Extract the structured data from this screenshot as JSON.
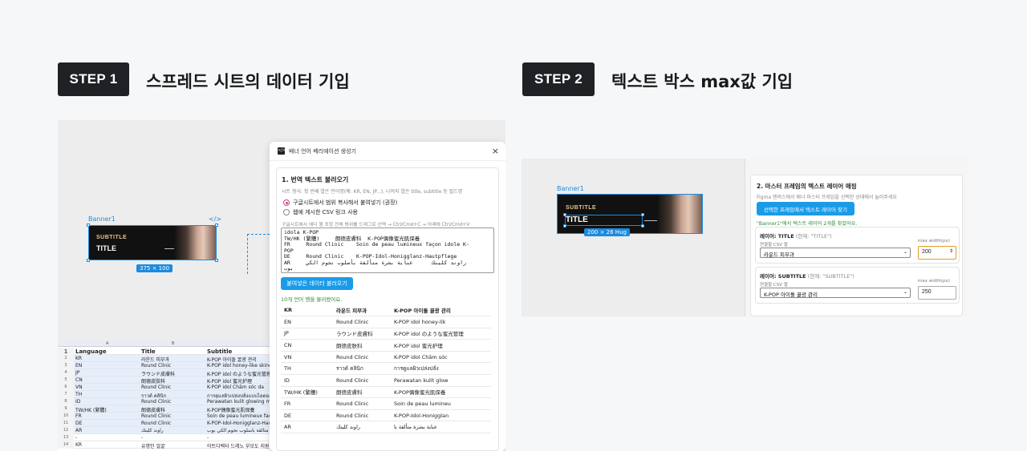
{
  "step1": {
    "badge": "STEP 1",
    "title": "스프레드 시트의 데이터 기입"
  },
  "step2": {
    "badge": "STEP 2",
    "title": "텍스트 박스 max값 기입"
  },
  "left": {
    "frame_label": "Banner1",
    "frame_code_icon": "</>",
    "banner_subtitle": "SUBTITLE",
    "banner_title": "TITLE",
    "dimension": "375 × 100",
    "sheet": {
      "col_letters": [
        "A",
        "B"
      ],
      "header": [
        "Language",
        "Title",
        "Subtitle"
      ],
      "rows": [
        [
          "1",
          "",
          "",
          ""
        ],
        [
          "2",
          "KR",
          "라운드 피부과",
          "K-POP 아이돌 꿀광 관리"
        ],
        [
          "3",
          "EN",
          "Round Clinic",
          "K-POP idol honey-like skincare"
        ],
        [
          "4",
          "JP",
          "ラウンド皮膚科",
          "K-POP idol のような蜜光管理"
        ],
        [
          "5",
          "CN",
          "朗德皮肤科",
          "K-POP idol 蜜光护理"
        ],
        [
          "6",
          "VN",
          "Round Clinic",
          "K-POP idol Chăm sóc da"
        ],
        [
          "7",
          "TH",
          "ราวด์ คลินิก",
          "การดูแลผิวเปล่งปลั่งแบบไอดอล"
        ],
        [
          "8",
          "ID",
          "Round Clinic",
          "Perawatan kulit glowing madu"
        ],
        [
          "9",
          "TW/HK (繁體)",
          "朗德皮膚科",
          "K-POP偶像蜜光肌保養"
        ],
        [
          "10",
          "FR",
          "Round Clinic",
          "Soin de peau lumineux façon"
        ],
        [
          "11",
          "DE",
          "Round Clinic",
          "K-POP-Idol-Honigglanz-Hautp"
        ],
        [
          "12",
          "AR",
          "راوند كلينك",
          "عناية بشرة متألقة بأسلوب نجوم الكي بوب"
        ],
        [
          "13",
          "-",
          "-",
          "-"
        ],
        [
          "14",
          "KR",
          "유명인 얼굴",
          "아트디렉터 드레노 부모도 지원"
        ]
      ]
    },
    "dialog": {
      "icon": "</>",
      "title": "배너 언어 베리에이션 생성기",
      "close": "×",
      "section_title": "1. 번역 텍스트 불러오기",
      "section_hint": "시트 형식: 첫 번째 열은 언어명(예: KR, EN, JP...), 나머지 열은 title, subtitle 등 필드명",
      "radio1": "구글시트에서 범위 복사해서 붙여넣기 (권장)",
      "radio2": "웹에 게시한 CSV 링크 사용",
      "paste_hint": "구글시트에서 헤더 행 포함 전체 범위를 드래그로 선택 → Ctrl/Cmd+C → 아래에 Ctrl/Cmd+V",
      "paste_text": "idola K-POP\nTW/HK (繁體)     朗德皮膚科  K-POP偶像蜜光肌保養\nFR     Round Clinic    Soin de peau lumineux façon idole K-\nPOP\nDE     Round Clinic    K-POP-Idol-Honigglanz-Hautpflege\nAR     راوند كلينك      عناية بشرة متألقة بأسلوب نجوم الكي\nبوب",
      "load_button": "붙여넣은 데이터 불러오기",
      "status": "10개 언어 행을 불러왔어요.",
      "table": {
        "header": [
          "KR",
          "라운드 피부과",
          "K-POP 아이돌 꿀광 관리"
        ],
        "rows": [
          [
            "EN",
            "Round Clinic",
            "K-POP idol honey-lik"
          ],
          [
            "JP",
            "ラウンド皮膚科",
            "K-POP idol のような蜜光管理"
          ],
          [
            "CN",
            "朗德皮肤科",
            "K-POP idol 蜜光护理"
          ],
          [
            "VN",
            "Round Clinic",
            "K-POP idol Chăm sóc"
          ],
          [
            "TH",
            "ราวด์ คลินิก",
            "การดูแลผิวเปล่งปลั่ง"
          ],
          [
            "ID",
            "Round Clinic",
            "Perawatan kulit glow"
          ],
          [
            "TW/HK (繁體)",
            "朗德皮膚科",
            "K-POP偶像蜜光肌保養"
          ],
          [
            "FR",
            "Round Clinic",
            "Soin de peau lumineu"
          ],
          [
            "DE",
            "Round Clinic",
            "K-POP-Idol-Honigglan"
          ],
          [
            "AR",
            "راوند كلينك",
            "عناية بشرة متألقة با"
          ]
        ]
      }
    }
  },
  "right": {
    "frame_label": "Banner1",
    "banner_subtitle": "SUBTITLE",
    "banner_title": "TITLE",
    "dimension": "200 × 26 Hug",
    "section_title": "2. 마스터 프레임의 텍스트 레이어 매핑",
    "section_hint": "Figma 캔버스에서 배너 마스터 프레임을 선택한 상태에서 눌러주세요",
    "find_button": "선택한 프레임에서 텍스트 레이어 찾기",
    "found_status": "\"Banner1\"에서 텍스트 레이어 2개를 찾았어요.",
    "layers": [
      {
        "title": "레이어: TITLE",
        "current": "(현재: \"TITLE\")",
        "csv_label": "연결할 CSV 열",
        "csv_value": "라운드 피부과",
        "max_label": "max width(px)",
        "max_value": "200"
      },
      {
        "title": "레이어: SUBTITLE",
        "current": "(현재: \"SUBTITLE\")",
        "csv_label": "연결할 CSV 열",
        "csv_value": "K-POP 아이돌 꿀광 관리",
        "max_label": "max width(px)",
        "max_value": "250"
      }
    ]
  },
  "colors": {
    "accent_blue": "#1a9be8",
    "selection_blue": "#1b8be0",
    "radio_pink": "#d63a8a",
    "focus_orange": "#e39b25",
    "success_green": "#2e8b3a"
  }
}
